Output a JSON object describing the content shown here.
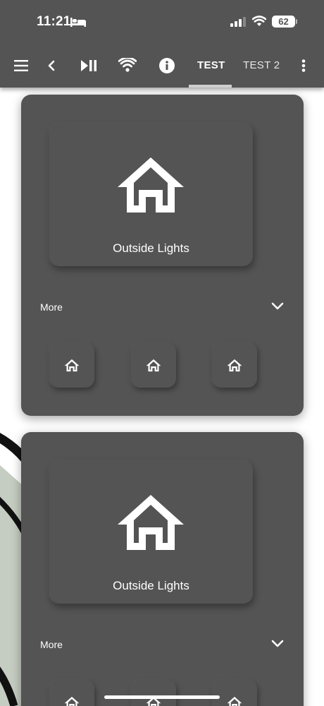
{
  "status_bar": {
    "time": "11:21",
    "battery_level": "62",
    "icons": [
      "bed-icon",
      "signal-bars-icon",
      "wifi-icon",
      "battery-icon"
    ]
  },
  "toolbar": {
    "icons": [
      "menu-icon",
      "back-icon",
      "play-pause-icon",
      "wifi-icon",
      "info-icon",
      "more-vertical-icon"
    ],
    "tabs": [
      {
        "label": "TEST",
        "active": true
      },
      {
        "label": "TEST 2",
        "active": false
      }
    ]
  },
  "cards": [
    {
      "main_tile": {
        "label": "Outside Lights",
        "icon": "home-icon"
      },
      "more_label": "More",
      "small_buttons": [
        {
          "icon": "home-icon"
        },
        {
          "icon": "home-icon"
        },
        {
          "icon": "home-icon"
        }
      ]
    },
    {
      "main_tile": {
        "label": "Outside Lights",
        "icon": "home-icon"
      },
      "more_label": "More",
      "small_buttons": [
        {
          "icon": "home-icon"
        },
        {
          "icon": "home-icon"
        },
        {
          "icon": "home-icon"
        }
      ]
    }
  ],
  "colors": {
    "header_bg": "#545454",
    "card_bg": "#545454",
    "page_bg": "#ffffff",
    "tab_indicator": "#cfcfcf",
    "text": "#ffffff"
  }
}
